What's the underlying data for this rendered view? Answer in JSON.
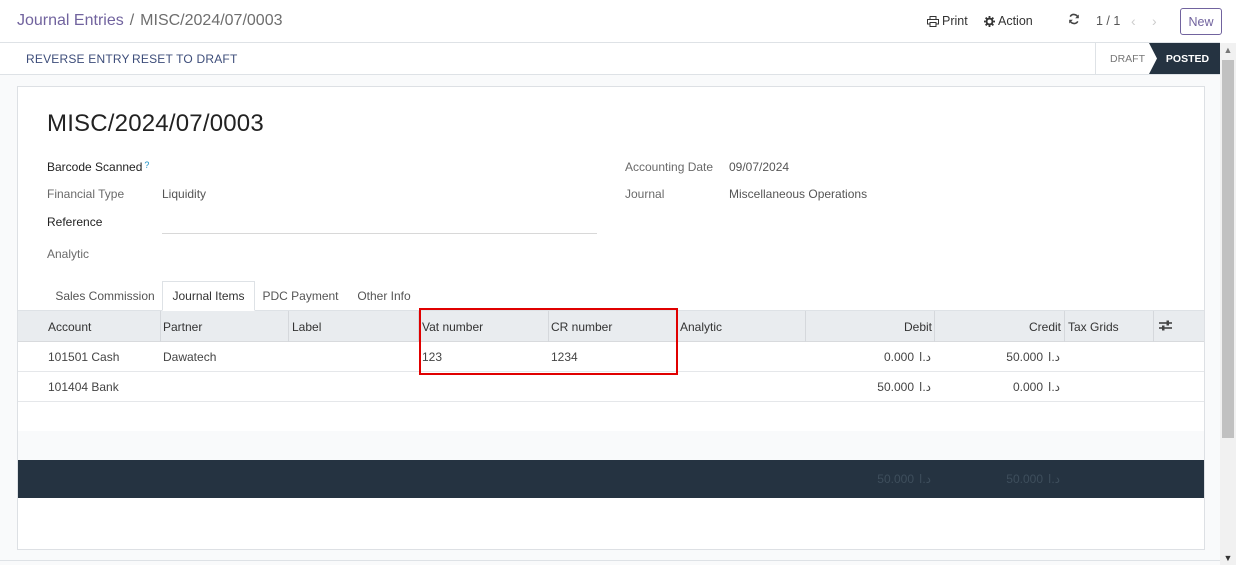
{
  "breadcrumb": {
    "parent": "Journal Entries",
    "separator": "/",
    "current": "MISC/2024/07/0003"
  },
  "toolbar": {
    "print": "Print",
    "action": "Action",
    "pager": "1 / 1",
    "new": "New"
  },
  "actions": {
    "reverse": "REVERSE ENTRY",
    "reset": "RESET TO DRAFT"
  },
  "status": {
    "draft": "DRAFT",
    "posted": "POSTED"
  },
  "record": {
    "title": "MISC/2024/07/0003"
  },
  "fields": {
    "barcode_label": "Barcode Scanned",
    "barcode_help": "?",
    "financial_type_label": "Financial Type",
    "financial_type_value": "Liquidity",
    "reference_label": "Reference",
    "analytic_label": "Analytic",
    "accounting_date_label": "Accounting Date",
    "accounting_date_value": "09/07/2024",
    "journal_label": "Journal",
    "journal_value": "Miscellaneous Operations"
  },
  "tabs": [
    "Sales Commission",
    "Journal Items",
    "PDC Payment",
    "Other Info"
  ],
  "table": {
    "headers": {
      "account": "Account",
      "partner": "Partner",
      "label": "Label",
      "vat": "Vat number",
      "cr": "CR number",
      "analytic": "Analytic",
      "debit": "Debit",
      "credit": "Credit",
      "tax_grids": "Tax Grids"
    },
    "rows": [
      {
        "account": "101501 Cash",
        "partner": "Dawatech",
        "label": "",
        "vat": "123",
        "cr": "1234",
        "analytic": "",
        "debit": "0.000",
        "credit": "50.000",
        "currency": "د.ا"
      },
      {
        "account": "101404 Bank",
        "partner": "",
        "label": "",
        "vat": "",
        "cr": "",
        "analytic": "",
        "debit": "50.000",
        "credit": "0.000",
        "currency": "د.ا"
      }
    ],
    "totals": {
      "debit": "50.000",
      "credit": "50.000",
      "currency": "د.ا"
    }
  },
  "colors": {
    "accent": "#71639e",
    "dark": "#253341",
    "highlight": "#e00000"
  }
}
